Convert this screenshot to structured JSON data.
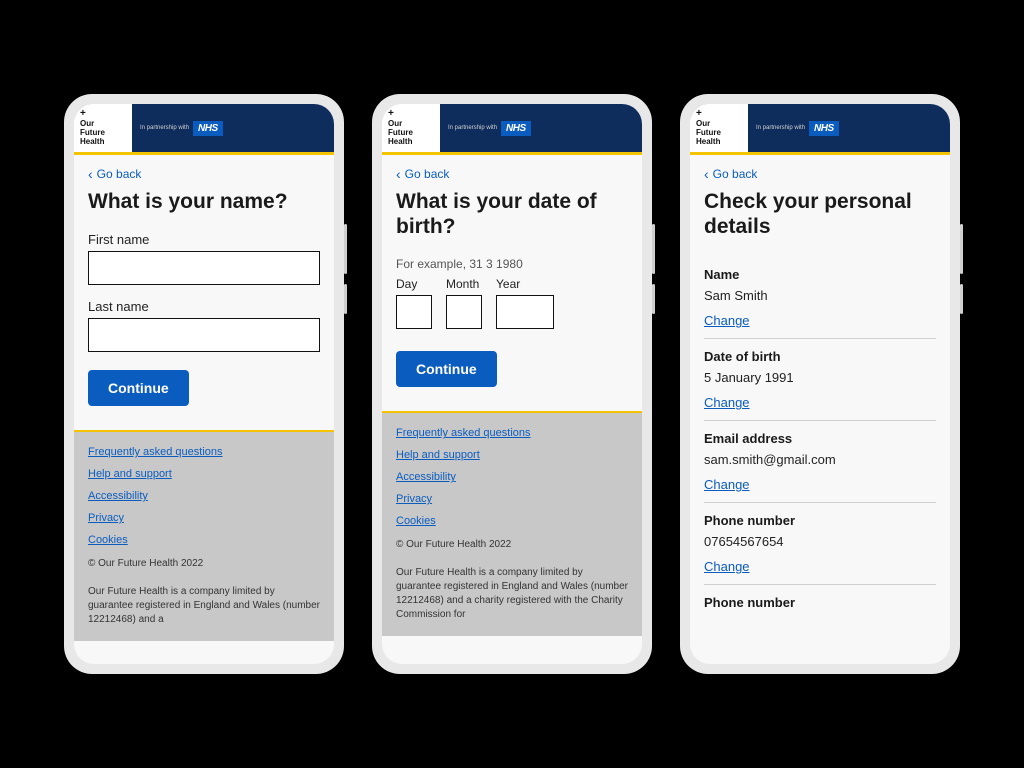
{
  "brand": {
    "plus": "+",
    "line1": "Our",
    "line2": "Future",
    "line3": "Health",
    "partnership": "In partnership with",
    "nhs": "NHS"
  },
  "common": {
    "go_back": "Go back",
    "continue": "Continue",
    "change": "Change"
  },
  "screen1": {
    "title": "What is your name?",
    "first_name_label": "First name",
    "last_name_label": "Last name"
  },
  "screen2": {
    "title": "What is your date of birth?",
    "hint": "For example, 31 3 1980",
    "day_label": "Day",
    "month_label": "Month",
    "year_label": "Year"
  },
  "screen3": {
    "title": "Check your personal details",
    "rows": {
      "name": {
        "label": "Name",
        "value": "Sam Smith"
      },
      "dob": {
        "label": "Date of birth",
        "value": "5 January 1991"
      },
      "email": {
        "label": "Email address",
        "value": "sam.smith@gmail.com"
      },
      "phone": {
        "label": "Phone number",
        "value": "07654567654"
      },
      "phone2": {
        "label": "Phone number"
      }
    }
  },
  "footer": {
    "links": {
      "faq": "Frequently asked questions",
      "help": "Help and support",
      "accessibility": "Accessibility",
      "privacy": "Privacy",
      "cookies": "Cookies"
    },
    "copyright": "© Our Future Health 2022",
    "legal1": "Our Future Health is a company limited by guarantee registered in England and Wales (number 12212468) and a",
    "legal2": "Our Future Health is a company limited by guarantee registered in England and Wales (number 12212468) and a charity registered with the Charity Commission for"
  }
}
